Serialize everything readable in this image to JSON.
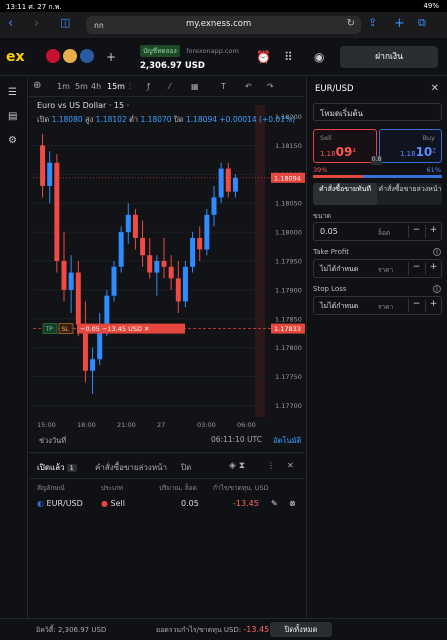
{
  "status_bar": {
    "time_date": "13:11  ศ. 27 ก.พ.",
    "battery": "49%"
  },
  "browser": {
    "tab_label": "กก",
    "url": "my.exness.com"
  },
  "header": {
    "logo": "ex",
    "account_type": "บัญชีทดลอง",
    "server": "forexonapp.com",
    "balance": "2,306.97 USD",
    "deposit_label": "ฝากเงิน"
  },
  "chart_toolbar": {
    "timeframes": [
      "1m",
      "5m",
      "4h",
      "15m"
    ],
    "active_timeframe": "15m"
  },
  "chart_data": {
    "type": "candlestick",
    "title": "Euro vs US Dollar · 15 ·",
    "ohlc": {
      "open_label": "เปิด",
      "open": "1.18080",
      "high_label": "สูง",
      "high": "1.18102",
      "low_label": "ต่ำ",
      "low": "1.18070",
      "close_label": "ปิด",
      "close": "1.18094",
      "change": "+0.00014 (+0.01%)"
    },
    "ylim": [
      1.1768,
      1.1822
    ],
    "y_ticks": [
      "1.18200",
      "1.18150",
      "1.18100",
      "1.18050",
      "1.18000",
      "1.17950",
      "1.17900",
      "1.17850",
      "1.17800",
      "1.17750",
      "1.17700"
    ],
    "x_ticks": [
      "15:00",
      "18:00",
      "21:00",
      "27",
      "03:00",
      "06:00"
    ],
    "current_price": "1.18094",
    "position_line_price": "1.17833",
    "position_label": {
      "tp": "TP",
      "sl": "SL",
      "pnl": "−0.05",
      "usd": "−13.45 USD"
    },
    "candles": [
      [
        1.1815,
        1.1817,
        1.1806,
        1.1808
      ],
      [
        1.1808,
        1.1814,
        1.1805,
        1.1812
      ],
      [
        1.1812,
        1.18135,
        1.1793,
        1.1795
      ],
      [
        1.1795,
        1.18,
        1.1788,
        1.179
      ],
      [
        1.179,
        1.1796,
        1.1786,
        1.1793
      ],
      [
        1.1793,
        1.1795,
        1.1782,
        1.1784
      ],
      [
        1.1784,
        1.1788,
        1.1774,
        1.1776
      ],
      [
        1.1776,
        1.178,
        1.1772,
        1.1778
      ],
      [
        1.1778,
        1.1786,
        1.1777,
        1.1784
      ],
      [
        1.1784,
        1.179,
        1.1782,
        1.1789
      ],
      [
        1.1789,
        1.1795,
        1.1788,
        1.1794
      ],
      [
        1.1794,
        1.1801,
        1.1793,
        1.18
      ],
      [
        1.18,
        1.1805,
        1.1798,
        1.1803
      ],
      [
        1.1803,
        1.1804,
        1.1797,
        1.1799
      ],
      [
        1.1799,
        1.1802,
        1.1794,
        1.1796
      ],
      [
        1.1796,
        1.1799,
        1.1792,
        1.1793
      ],
      [
        1.1793,
        1.1796,
        1.1789,
        1.1795
      ],
      [
        1.1795,
        1.1799,
        1.1792,
        1.1794
      ],
      [
        1.1794,
        1.1796,
        1.179,
        1.1792
      ],
      [
        1.1792,
        1.1795,
        1.1786,
        1.1788
      ],
      [
        1.1788,
        1.1795,
        1.1787,
        1.1794
      ],
      [
        1.1794,
        1.18,
        1.1793,
        1.1799
      ],
      [
        1.1799,
        1.1801,
        1.1795,
        1.1797
      ],
      [
        1.1797,
        1.1804,
        1.1796,
        1.1803
      ],
      [
        1.1803,
        1.1808,
        1.1801,
        1.1806
      ],
      [
        1.1806,
        1.1812,
        1.1805,
        1.1811
      ],
      [
        1.1811,
        1.1812,
        1.1806,
        1.1807
      ],
      [
        1.1807,
        1.181,
        1.1806,
        1.18094
      ]
    ],
    "time_readout": "06:11:10 UTC",
    "range_label": "ช่วงวันที่",
    "auto_label": "อัตโนมัติ"
  },
  "order_panel": {
    "symbol": "EUR/USD",
    "mode": "โหมดเริ่มต้น",
    "sell": {
      "label": "Sell",
      "price_main": "1.18",
      "price_big": "09",
      "price_sup": "4"
    },
    "buy": {
      "label": "Buy",
      "price_main": "1.18",
      "price_big": "10",
      "price_sup": "2"
    },
    "spread": "0.8",
    "sell_pct": "39%",
    "buy_pct": "61%",
    "order_tabs": [
      "คำสั่งซื้อขายทันที",
      "คำสั่งซื้อขายล่วงหน้า"
    ],
    "volume_label": "ขนาด",
    "volume": "0.05",
    "volume_unit": "ล็อต",
    "take_profit_label": "Take Profit",
    "take_profit_value": "ไม่ได้กำหนด",
    "stop_loss_label": "Stop Loss",
    "stop_loss_value": "ไม่ได้กำหนด",
    "price_unit": "ราคา"
  },
  "positions": {
    "tabs": [
      {
        "label": "เปิดแล้ว",
        "count": "1"
      },
      {
        "label": "คำสั่งซื้อขายล่วงหน้า"
      },
      {
        "label": "ปิด"
      }
    ],
    "columns": [
      "สัญลักษณ์",
      "ประเภท",
      "ปริมาณ, ล็อต",
      "กำไร/ขาดทุน, USD"
    ],
    "rows": [
      {
        "symbol": "EUR/USD",
        "type": "Sell",
        "volume": "0.05",
        "pnl": "-13.45"
      }
    ]
  },
  "footer": {
    "equity_label": "อิควิตี้:",
    "equity": "2,306.97 USD",
    "total_pnl_label": "ยอดรวมกำไร/ขาดทุน USD:",
    "total_pnl": "-13.45",
    "close_all": "ปิดทั้งหมด"
  },
  "colors": {
    "accent": "#ffd200",
    "sell": "#e4473d",
    "buy": "#3a6fd8",
    "up": "#2f8cff",
    "down": "#ef4a43"
  }
}
